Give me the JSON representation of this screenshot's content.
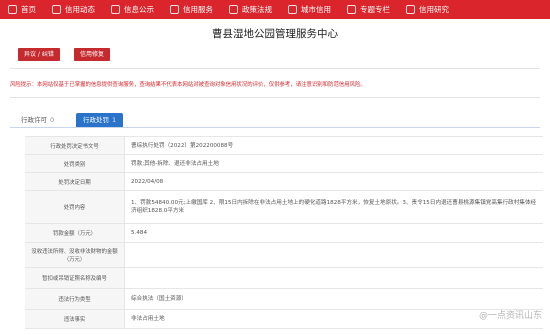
{
  "nav": [
    {
      "label": "首页",
      "icon": "home-icon"
    },
    {
      "label": "信用动态",
      "icon": "news-icon"
    },
    {
      "label": "信息公示",
      "icon": "info-icon"
    },
    {
      "label": "信用服务",
      "icon": "service-icon"
    },
    {
      "label": "政策法规",
      "icon": "policy-icon"
    },
    {
      "label": "城市信用",
      "icon": "city-icon"
    },
    {
      "label": "专题专栏",
      "icon": "topic-icon"
    },
    {
      "label": "信用研究",
      "icon": "research-icon"
    }
  ],
  "page_title": "曹县湿地公园管理服务中心",
  "buttons": {
    "objection": "异议 / 纠错",
    "repair": "信用修复"
  },
  "notice": "风险提示：本网站仅基于已掌握的信息提供查询服务，查询结果不代表本网站对被查询对象信用状况的评价，仅供参考，请注意识别和防范信用风险。",
  "tabs": [
    {
      "label": "行政许可",
      "count": "0"
    },
    {
      "label": "行政处罚",
      "count": "1"
    }
  ],
  "details": [
    {
      "label": "行政处罚决定书文号",
      "value": "曹综执行处罚（2022）第202200088号"
    },
    {
      "label": "处罚类别",
      "value": "罚款;其他-拆除、退还非法占用土地"
    },
    {
      "label": "处罚决定日期",
      "value": "2022/04/08"
    },
    {
      "label": "处罚内容",
      "value": "1、罚款54840.00元;上缴国库 2、限15日内拆除在非法占用土地上的硬化道路1828平方米，恢复土地原状。3、责令15日内退还曹县桃源集镇党高集行政村集体经济组织1828.0平方米"
    },
    {
      "label": "罚款金额（万元）",
      "value": "5.484"
    },
    {
      "label": "没收违法所得、没收非法财物的金额（万元）",
      "value": ""
    },
    {
      "label": "暂扣或吊销证照名称及编号",
      "value": ""
    },
    {
      "label": "违法行为类型",
      "value": "综合执法（国土资源）"
    },
    {
      "label": "违法事实",
      "value": "非法占用土地"
    }
  ],
  "watermark": "@一点资讯山东"
}
